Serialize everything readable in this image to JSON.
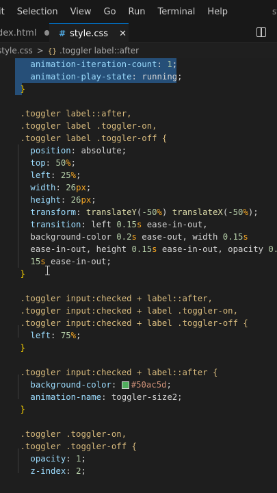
{
  "menubar": {
    "items": [
      "it",
      "Selection",
      "View",
      "Go",
      "Run",
      "Terminal",
      "Help"
    ],
    "title_fragment": "st"
  },
  "tabs": {
    "inactive": {
      "label": "dex.html"
    },
    "active": {
      "label": "style.css",
      "icon": "#",
      "close": "✕"
    }
  },
  "breadcrumb": {
    "file": "style.css",
    "separator": ">",
    "symbol_icon": "{}",
    "symbol": ".toggler label::after"
  },
  "colors": {
    "accent": "#0078d4",
    "selection": "#264f78",
    "swatch": "#50ac5d"
  },
  "code": {
    "l1": [
      "animation-iteration-count",
      ": ",
      "1",
      ";"
    ],
    "l2": [
      "animation-play-state",
      ": ",
      "running",
      ";"
    ],
    "l3": "}",
    "l5": ".toggler label::after,",
    "l6": ".toggler label .toggler-on,",
    "l7": ".toggler label .toggler-off {",
    "position": [
      "position",
      "absolute"
    ],
    "top": [
      "top",
      "50",
      "%"
    ],
    "left": [
      "left",
      "25",
      "%"
    ],
    "width": [
      "width",
      "26",
      "px"
    ],
    "height": [
      "height",
      "26",
      "px"
    ],
    "transform": [
      "transform",
      "translateY",
      "-50",
      "%",
      "translateX",
      "-50",
      "%"
    ],
    "transition": {
      "line1": [
        "transition",
        "left ",
        "0.15",
        "s",
        " ease-in-out,"
      ],
      "line2": [
        "background-color ",
        "0.2",
        "s",
        " ease-out, width ",
        "0.15",
        "s"
      ],
      "line3": [
        "ease-in-out, height ",
        "0.15",
        "s",
        " ease-in-out, opacity ",
        "0."
      ],
      "line4": [
        "15",
        "s",
        " ease-in-out;"
      ]
    },
    "close2": "}",
    "c2_1": ".toggler input:checked + label::after,",
    "c2_2": ".toggler input:checked + label .toggler-on,",
    "c2_3": ".toggler input:checked + label .toggler-off {",
    "c2_left": [
      "left",
      "75",
      "%"
    ],
    "close3": "}",
    "c3_1": ".toggler input:checked + label::after {",
    "c3_bg": [
      "background-color",
      "#50ac5d"
    ],
    "c3_anim": [
      "animation-name",
      "toggler-size2"
    ],
    "close4": "}",
    "c4_1": ".toggler .toggler-on,",
    "c4_2": ".toggler .toggler-off {",
    "c4_op": [
      "opacity",
      "1"
    ],
    "c4_z": [
      "z-index",
      "2"
    ]
  }
}
